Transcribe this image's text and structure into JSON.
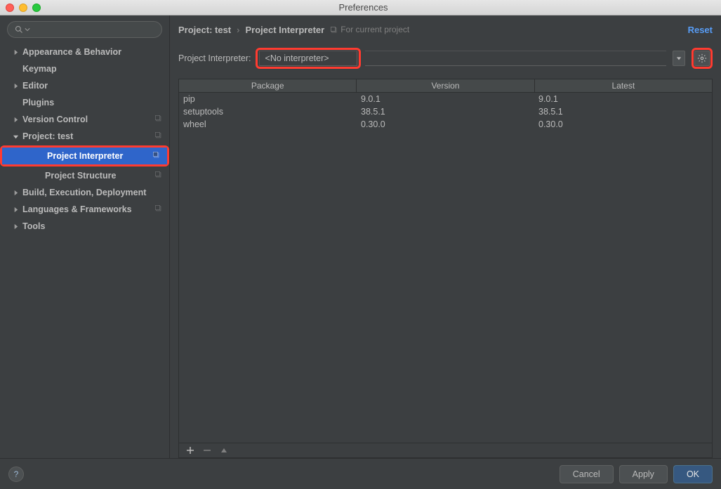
{
  "window_title": "Preferences",
  "search_placeholder": "",
  "sidebar": {
    "items": [
      {
        "label": "Appearance & Behavior",
        "expandable": true,
        "expanded": false,
        "level": 0
      },
      {
        "label": "Keymap",
        "expandable": false,
        "level": 0
      },
      {
        "label": "Editor",
        "expandable": true,
        "expanded": false,
        "level": 0
      },
      {
        "label": "Plugins",
        "expandable": false,
        "level": 0
      },
      {
        "label": "Version Control",
        "expandable": true,
        "expanded": false,
        "level": 0,
        "badge": true
      },
      {
        "label": "Project: test",
        "expandable": true,
        "expanded": true,
        "level": 0,
        "badge": true
      },
      {
        "label": "Project Interpreter",
        "expandable": false,
        "level": 1,
        "selected": true,
        "highlighted": true,
        "badge": true
      },
      {
        "label": "Project Structure",
        "expandable": false,
        "level": 1,
        "badge": true
      },
      {
        "label": "Build, Execution, Deployment",
        "expandable": true,
        "expanded": false,
        "level": 0
      },
      {
        "label": "Languages & Frameworks",
        "expandable": true,
        "expanded": false,
        "level": 0,
        "badge": true
      },
      {
        "label": "Tools",
        "expandable": true,
        "expanded": false,
        "level": 0
      }
    ]
  },
  "breadcrumb": {
    "project_label": "Project: test",
    "page_label": "Project Interpreter",
    "hint": "For current project",
    "reset_label": "Reset"
  },
  "interpreter": {
    "label": "Project Interpreter:",
    "value": "<No interpreter>"
  },
  "packages": {
    "columns": [
      "Package",
      "Version",
      "Latest"
    ],
    "rows": [
      {
        "package": "pip",
        "version": "9.0.1",
        "latest": "9.0.1"
      },
      {
        "package": "setuptools",
        "version": "38.5.1",
        "latest": "38.5.1"
      },
      {
        "package": "wheel",
        "version": "0.30.0",
        "latest": "0.30.0"
      }
    ]
  },
  "footer": {
    "cancel": "Cancel",
    "apply": "Apply",
    "ok": "OK"
  },
  "colors": {
    "highlight": "#ff3b30",
    "selection": "#2f65ca",
    "link": "#589df6"
  }
}
